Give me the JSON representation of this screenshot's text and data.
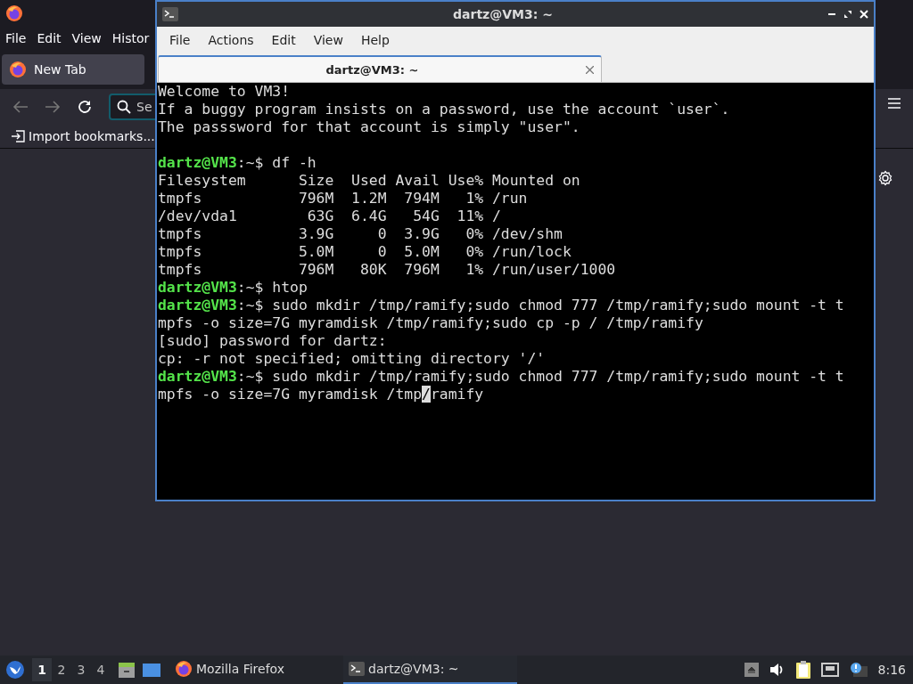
{
  "browser": {
    "menu": [
      "File",
      "Edit",
      "View",
      "Histor"
    ],
    "tabs": [
      {
        "label": "New Tab",
        "selected": true
      }
    ],
    "search": {
      "placeholder": "Se"
    },
    "bookmarks": [
      "Import bookmarks..."
    ]
  },
  "terminal": {
    "title": "dartz@VM3: ~",
    "menu": [
      "File",
      "Actions",
      "Edit",
      "View",
      "Help"
    ],
    "tabs": [
      {
        "label": "dartz@VM3: ~",
        "selected": true
      }
    ],
    "lines": [
      {
        "kind": "output",
        "text": "Welcome to VM3!"
      },
      {
        "kind": "output",
        "text": "If a buggy program insists on a password, use the account `user`."
      },
      {
        "kind": "output",
        "text": "The passsword for that account is simply \"user\"."
      },
      {
        "kind": "blank"
      },
      {
        "kind": "prompt",
        "user": "dartz@VM3",
        "path": ":~$",
        "text": " df -h"
      },
      {
        "kind": "output",
        "text": "Filesystem      Size  Used Avail Use% Mounted on"
      },
      {
        "kind": "output",
        "text": "tmpfs           796M  1.2M  794M   1% /run"
      },
      {
        "kind": "output",
        "text": "/dev/vda1        63G  6.4G   54G  11% /"
      },
      {
        "kind": "output",
        "text": "tmpfs           3.9G     0  3.9G   0% /dev/shm"
      },
      {
        "kind": "output",
        "text": "tmpfs           5.0M     0  5.0M   0% /run/lock"
      },
      {
        "kind": "output",
        "text": "tmpfs           796M   80K  796M   1% /run/user/1000"
      },
      {
        "kind": "prompt",
        "user": "dartz@VM3",
        "path": ":~$",
        "text": " htop"
      },
      {
        "kind": "prompt",
        "user": "dartz@VM3",
        "path": ":~$",
        "text": " sudo mkdir /tmp/ramify;sudo chmod 777 /tmp/ramify;sudo mount -t t"
      },
      {
        "kind": "output",
        "text": "mpfs -o size=7G myramdisk /tmp/ramify;sudo cp -p / /tmp/ramify"
      },
      {
        "kind": "output",
        "text": "[sudo] password for dartz:"
      },
      {
        "kind": "output",
        "text": "cp: -r not specified; omitting directory '/'"
      },
      {
        "kind": "prompt",
        "user": "dartz@VM3",
        "path": ":~$",
        "text": " sudo mkdir /tmp/ramify;sudo chmod 777 /tmp/ramify;sudo mount -t t"
      },
      {
        "kind": "cursor",
        "text": "mpfs -o size=7G myramdisk /tmp",
        "cursor": "/",
        "after": "ramify"
      }
    ]
  },
  "taskbar": {
    "workspaces": [
      {
        "label": "1",
        "selected": true
      },
      {
        "label": "2",
        "selected": false
      },
      {
        "label": "3",
        "selected": false
      },
      {
        "label": "4",
        "selected": false
      }
    ],
    "tasks": [
      {
        "label": "Mozilla Firefox",
        "kind": "firefox",
        "selected": false
      },
      {
        "label": "dartz@VM3: ~",
        "kind": "terminal",
        "selected": true
      }
    ],
    "clock": "8:16"
  }
}
